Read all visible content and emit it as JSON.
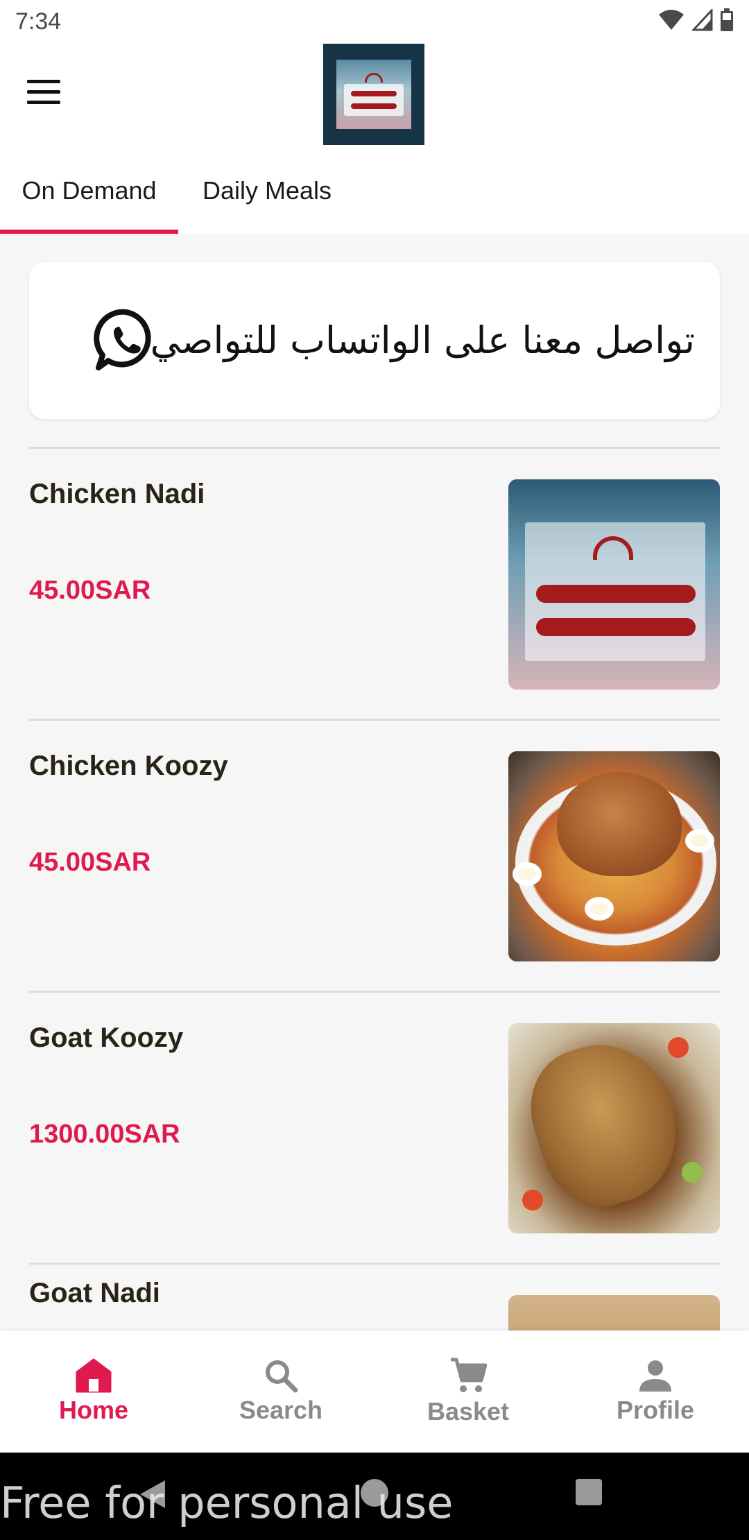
{
  "status_bar": {
    "time": "7:34",
    "icons": [
      "wifi-icon",
      "cell-signal-icon",
      "battery-icon"
    ]
  },
  "app_bar": {
    "menu_icon": "hamburger-menu-icon",
    "logo_alt": "مطابخ الرضا والأخوان الحديثة"
  },
  "tabs": [
    {
      "label": "On Demand",
      "active": true
    },
    {
      "label": "Daily Meals",
      "active": false
    }
  ],
  "banner": {
    "text": "تواصل معنا على الواتساب للتواصي",
    "icon": "whatsapp-icon"
  },
  "menu_items": [
    {
      "name": "Chicken Nadi",
      "price": "45.00SAR"
    },
    {
      "name": "Chicken Koozy",
      "price": "45.00SAR"
    },
    {
      "name": "Goat Koozy",
      "price": "1300.00SAR"
    },
    {
      "name": "Goat Nadi",
      "price": ""
    }
  ],
  "bottom_nav": [
    {
      "label": "Home",
      "icon": "home-icon",
      "active": true
    },
    {
      "label": "Search",
      "icon": "search-icon",
      "active": false
    },
    {
      "label": "Basket",
      "icon": "cart-icon",
      "active": false
    },
    {
      "label": "Profile",
      "icon": "person-icon",
      "active": false
    }
  ],
  "watermark": "Free for personal use",
  "colors": {
    "accent": "#e0194f",
    "text": "#2a2418",
    "inactive": "#8a8a8a",
    "background": "#f6f6f6"
  }
}
